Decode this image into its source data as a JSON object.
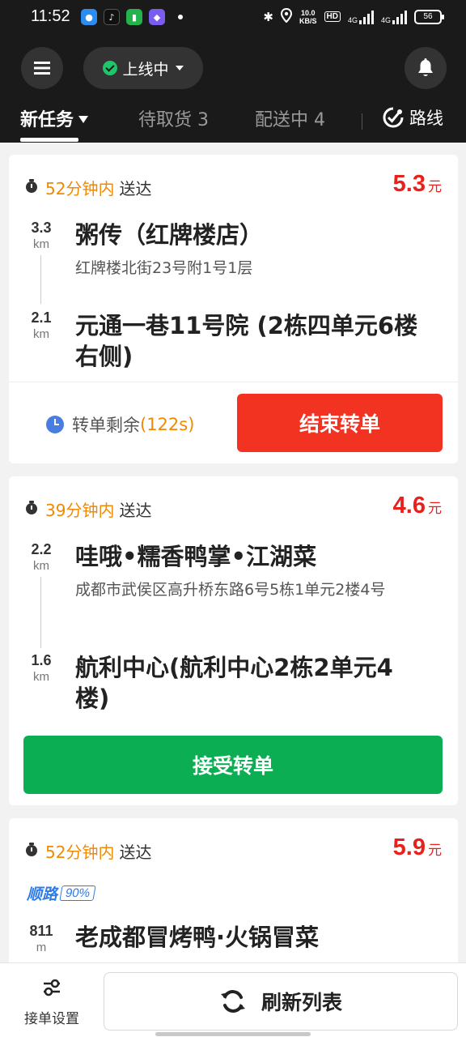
{
  "status_bar": {
    "time": "11:52",
    "speed_value": "10.0",
    "speed_unit": "KB/S",
    "hd_label": "HD",
    "network_1": "4G",
    "network_2": "4G",
    "battery": "56"
  },
  "header": {
    "online_status": "上线中",
    "tabs": [
      {
        "label": "新任务"
      },
      {
        "label": "待取货 3"
      },
      {
        "label": "配送中 4"
      }
    ],
    "route_label": "路线"
  },
  "orders": [
    {
      "deadline_time": "52分钟内",
      "deadline_suffix": "送达",
      "price": "5.3",
      "price_unit": "元",
      "pickup_dist": "3.3",
      "pickup_unit": "km",
      "pickup_name": "粥传（红牌楼店）",
      "pickup_address": "红牌楼北街23号附1号1层",
      "dropoff_dist": "2.1",
      "dropoff_unit": "km",
      "dropoff_name": "元通一巷11号院 (2栋四单元6楼右侧)",
      "countdown_label": "转单剩余",
      "countdown_value": "(122s)",
      "action_label": "结束转单"
    },
    {
      "deadline_time": "39分钟内",
      "deadline_suffix": "送达",
      "price": "4.6",
      "price_unit": "元",
      "pickup_dist": "2.2",
      "pickup_unit": "km",
      "pickup_name": "哇哦•糯香鸭掌•江湖菜",
      "pickup_address": "成都市武侯区高升桥东路6号5栋1单元2楼4号",
      "dropoff_dist": "1.6",
      "dropoff_unit": "km",
      "dropoff_name": "航利中心(航利中心2栋2单元4楼)",
      "action_label": "接受转单"
    },
    {
      "deadline_time": "52分钟内",
      "deadline_suffix": "送达",
      "price": "5.9",
      "price_unit": "元",
      "route_tag": "顺路",
      "route_match": "90%",
      "pickup_dist": "811",
      "pickup_unit": "m",
      "pickup_name": "老成都冒烤鸭·火锅冒菜"
    }
  ],
  "bottom": {
    "settings_label": "接单设置",
    "refresh_label": "刷新列表"
  },
  "colors": {
    "header_bg": "#1a1a1a",
    "price_red": "#e8211d",
    "deadline_orange": "#f08a00",
    "end_button_red": "#f23322",
    "accept_button_green": "#0cae54",
    "online_green": "#1ec66a",
    "route_blue": "#2f7be5"
  }
}
